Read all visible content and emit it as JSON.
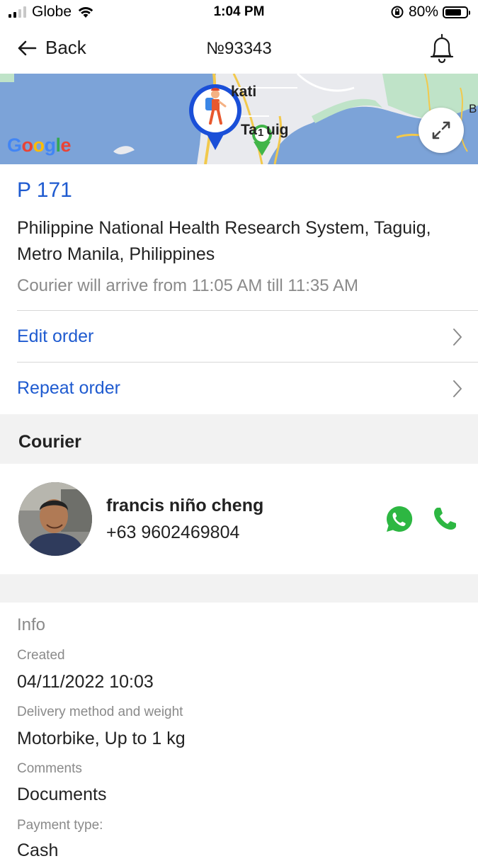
{
  "status_bar": {
    "carrier": "Globe",
    "time": "1:04 PM",
    "battery_percent": "80%",
    "battery_level": 0.8
  },
  "nav": {
    "back_label": "Back",
    "title": "№93343",
    "bell_icon": "bell-icon"
  },
  "map": {
    "labels": [
      "kati",
      "Ta",
      "uig",
      "B"
    ],
    "pin_number": "1",
    "google_letters": [
      "G",
      "o",
      "o",
      "g",
      "l",
      "e"
    ],
    "colors": {
      "water": "#7ca3d8",
      "land": "#e9eaee",
      "park": "#bfe3c8",
      "road": "#f2c94c"
    }
  },
  "order": {
    "code": "P 171",
    "address": "Philippine National Health Research System, Taguig, Metro Manila, Philippines",
    "eta": "Courier will arrive from 11:05 AM till 11:35 AM",
    "edit_label": "Edit order",
    "repeat_label": "Repeat order"
  },
  "courier": {
    "section_title": "Courier",
    "name": "francis niño cheng",
    "phone": "+63 9602469804",
    "whatsapp_color": "#2db742",
    "call_color": "#2db742"
  },
  "info": {
    "title": "Info",
    "created_label": "Created",
    "created_value": "04/11/2022 10:03",
    "delivery_label": "Delivery method and weight",
    "delivery_value": "Motorbike, Up to 1 kg",
    "comments_label": "Comments",
    "comments_value": "Documents",
    "payment_label": "Payment type:",
    "payment_value": "Cash"
  },
  "accent_color": "#1f5bd0"
}
